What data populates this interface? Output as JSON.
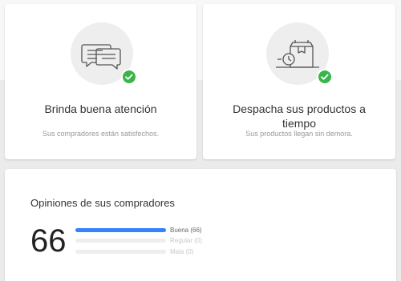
{
  "cards": [
    {
      "icon": "chat-bubbles-icon",
      "title": "Brinda buena atención",
      "subtitle": "Sus compradores están satisfechos."
    },
    {
      "icon": "delivery-box-clock-icon",
      "title": "Despacha sus productos a tiempo",
      "subtitle": "Sus productos llegan sin demora."
    }
  ],
  "badge_icon": "check-icon",
  "opinions": {
    "title": "Opiniones de sus compradores",
    "score": "66",
    "bars": [
      {
        "label": "Buena (66)",
        "fraction": 1.0,
        "active": true
      },
      {
        "label": "Regular (0)",
        "fraction": 0.0,
        "active": false
      },
      {
        "label": "Mala (0)",
        "fraction": 0.0,
        "active": false
      }
    ]
  },
  "colors": {
    "accent_blue": "#3483fa",
    "check_green": "#39b54a",
    "icon_bg": "#eeeeee"
  }
}
